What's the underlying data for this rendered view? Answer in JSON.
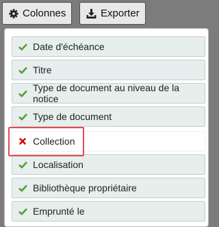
{
  "toolbar": {
    "columns_label": "Colonnes",
    "export_label": "Exporter"
  },
  "columns_menu": {
    "items": [
      {
        "label": "Date d'échéance",
        "checked": true
      },
      {
        "label": "Titre",
        "checked": true
      },
      {
        "label": "Type de document au niveau de la notice",
        "checked": true
      },
      {
        "label": "Type de document",
        "checked": true
      },
      {
        "label": "Collection",
        "checked": false
      },
      {
        "label": "Localisation",
        "checked": true
      },
      {
        "label": "Bibliothèque propriétaire",
        "checked": true
      },
      {
        "label": "Emprunté le",
        "checked": true
      }
    ]
  },
  "colors": {
    "check": "#5a9e2f",
    "cross": "#cc0000",
    "highlight": "#e34a4f"
  }
}
